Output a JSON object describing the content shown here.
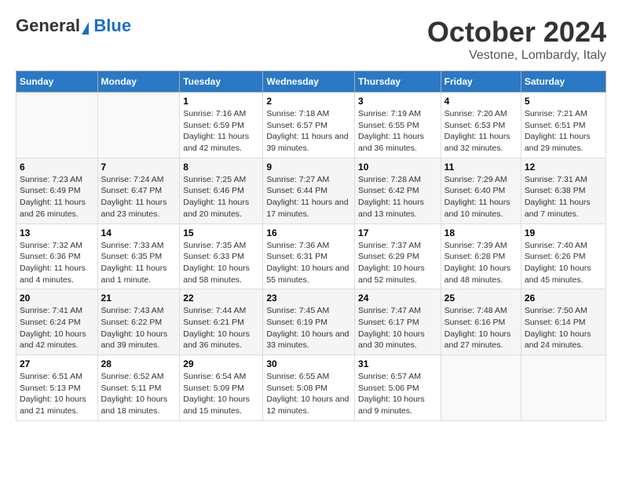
{
  "header": {
    "logo_general": "General",
    "logo_blue": "Blue",
    "title": "October 2024",
    "subtitle": "Vestone, Lombardy, Italy"
  },
  "days_of_week": [
    "Sunday",
    "Monday",
    "Tuesday",
    "Wednesday",
    "Thursday",
    "Friday",
    "Saturday"
  ],
  "weeks": [
    [
      {
        "day": "",
        "info": ""
      },
      {
        "day": "",
        "info": ""
      },
      {
        "day": "1",
        "info": "Sunrise: 7:16 AM\nSunset: 6:59 PM\nDaylight: 11 hours and 42 minutes."
      },
      {
        "day": "2",
        "info": "Sunrise: 7:18 AM\nSunset: 6:57 PM\nDaylight: 11 hours and 39 minutes."
      },
      {
        "day": "3",
        "info": "Sunrise: 7:19 AM\nSunset: 6:55 PM\nDaylight: 11 hours and 36 minutes."
      },
      {
        "day": "4",
        "info": "Sunrise: 7:20 AM\nSunset: 6:53 PM\nDaylight: 11 hours and 32 minutes."
      },
      {
        "day": "5",
        "info": "Sunrise: 7:21 AM\nSunset: 6:51 PM\nDaylight: 11 hours and 29 minutes."
      }
    ],
    [
      {
        "day": "6",
        "info": "Sunrise: 7:23 AM\nSunset: 6:49 PM\nDaylight: 11 hours and 26 minutes."
      },
      {
        "day": "7",
        "info": "Sunrise: 7:24 AM\nSunset: 6:47 PM\nDaylight: 11 hours and 23 minutes."
      },
      {
        "day": "8",
        "info": "Sunrise: 7:25 AM\nSunset: 6:46 PM\nDaylight: 11 hours and 20 minutes."
      },
      {
        "day": "9",
        "info": "Sunrise: 7:27 AM\nSunset: 6:44 PM\nDaylight: 11 hours and 17 minutes."
      },
      {
        "day": "10",
        "info": "Sunrise: 7:28 AM\nSunset: 6:42 PM\nDaylight: 11 hours and 13 minutes."
      },
      {
        "day": "11",
        "info": "Sunrise: 7:29 AM\nSunset: 6:40 PM\nDaylight: 11 hours and 10 minutes."
      },
      {
        "day": "12",
        "info": "Sunrise: 7:31 AM\nSunset: 6:38 PM\nDaylight: 11 hours and 7 minutes."
      }
    ],
    [
      {
        "day": "13",
        "info": "Sunrise: 7:32 AM\nSunset: 6:36 PM\nDaylight: 11 hours and 4 minutes."
      },
      {
        "day": "14",
        "info": "Sunrise: 7:33 AM\nSunset: 6:35 PM\nDaylight: 11 hours and 1 minute."
      },
      {
        "day": "15",
        "info": "Sunrise: 7:35 AM\nSunset: 6:33 PM\nDaylight: 10 hours and 58 minutes."
      },
      {
        "day": "16",
        "info": "Sunrise: 7:36 AM\nSunset: 6:31 PM\nDaylight: 10 hours and 55 minutes."
      },
      {
        "day": "17",
        "info": "Sunrise: 7:37 AM\nSunset: 6:29 PM\nDaylight: 10 hours and 52 minutes."
      },
      {
        "day": "18",
        "info": "Sunrise: 7:39 AM\nSunset: 6:28 PM\nDaylight: 10 hours and 48 minutes."
      },
      {
        "day": "19",
        "info": "Sunrise: 7:40 AM\nSunset: 6:26 PM\nDaylight: 10 hours and 45 minutes."
      }
    ],
    [
      {
        "day": "20",
        "info": "Sunrise: 7:41 AM\nSunset: 6:24 PM\nDaylight: 10 hours and 42 minutes."
      },
      {
        "day": "21",
        "info": "Sunrise: 7:43 AM\nSunset: 6:22 PM\nDaylight: 10 hours and 39 minutes."
      },
      {
        "day": "22",
        "info": "Sunrise: 7:44 AM\nSunset: 6:21 PM\nDaylight: 10 hours and 36 minutes."
      },
      {
        "day": "23",
        "info": "Sunrise: 7:45 AM\nSunset: 6:19 PM\nDaylight: 10 hours and 33 minutes."
      },
      {
        "day": "24",
        "info": "Sunrise: 7:47 AM\nSunset: 6:17 PM\nDaylight: 10 hours and 30 minutes."
      },
      {
        "day": "25",
        "info": "Sunrise: 7:48 AM\nSunset: 6:16 PM\nDaylight: 10 hours and 27 minutes."
      },
      {
        "day": "26",
        "info": "Sunrise: 7:50 AM\nSunset: 6:14 PM\nDaylight: 10 hours and 24 minutes."
      }
    ],
    [
      {
        "day": "27",
        "info": "Sunrise: 6:51 AM\nSunset: 5:13 PM\nDaylight: 10 hours and 21 minutes."
      },
      {
        "day": "28",
        "info": "Sunrise: 6:52 AM\nSunset: 5:11 PM\nDaylight: 10 hours and 18 minutes."
      },
      {
        "day": "29",
        "info": "Sunrise: 6:54 AM\nSunset: 5:09 PM\nDaylight: 10 hours and 15 minutes."
      },
      {
        "day": "30",
        "info": "Sunrise: 6:55 AM\nSunset: 5:08 PM\nDaylight: 10 hours and 12 minutes."
      },
      {
        "day": "31",
        "info": "Sunrise: 6:57 AM\nSunset: 5:06 PM\nDaylight: 10 hours and 9 minutes."
      },
      {
        "day": "",
        "info": ""
      },
      {
        "day": "",
        "info": ""
      }
    ]
  ]
}
